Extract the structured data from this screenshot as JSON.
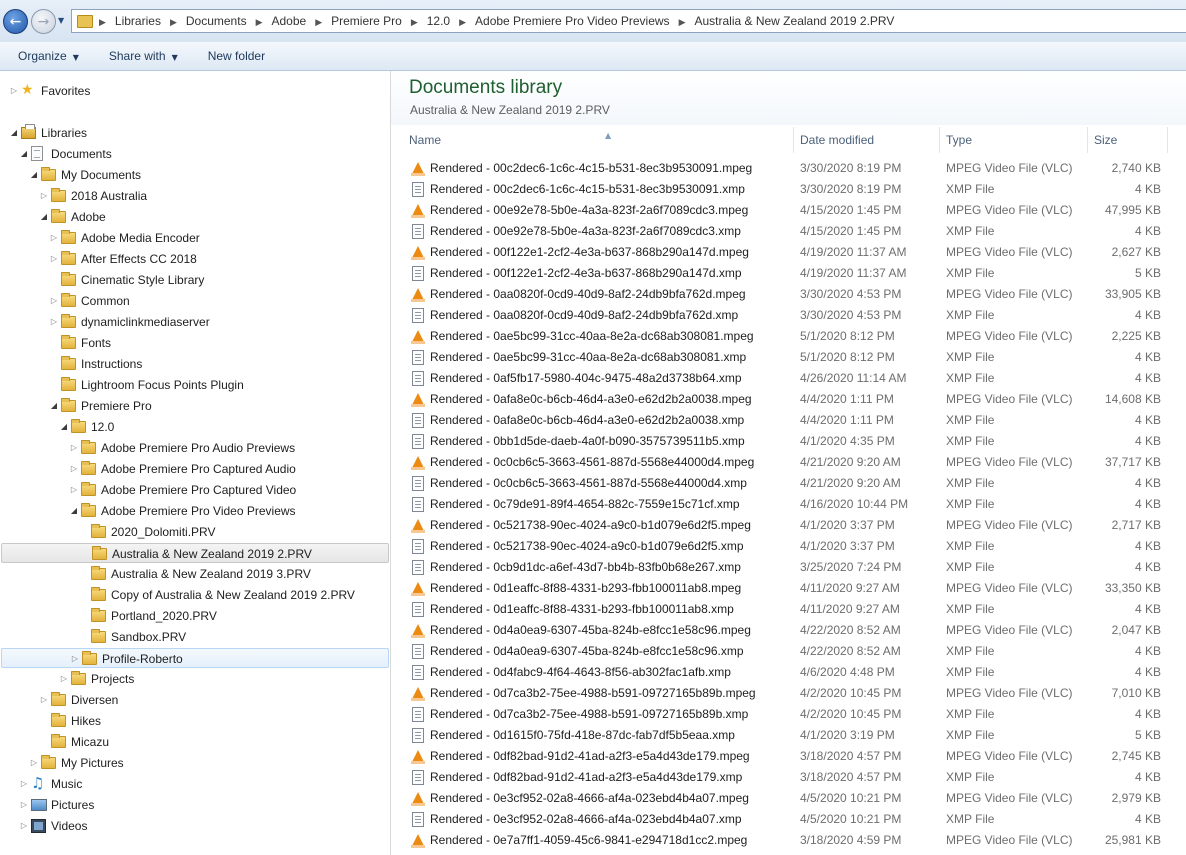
{
  "address_bar": {
    "breadcrumbs": [
      "Libraries",
      "Documents",
      "Adobe",
      "Premiere Pro",
      "12.0",
      "Adobe Premiere Pro Video Previews",
      "Australia & New Zealand 2019 2.PRV"
    ]
  },
  "toolbar": {
    "organize_label": "Organize",
    "share_label": "Share with",
    "new_folder_label": "New folder"
  },
  "nav_tree": [
    {
      "label": "Favorites",
      "level": 0,
      "icon": "star-icon",
      "arrow": "collapsed"
    },
    {
      "label": "Libraries",
      "level": 0,
      "icon": "library-icon",
      "arrow": "expanded"
    },
    {
      "label": "Documents",
      "level": 1,
      "icon": "document-library-icon",
      "arrow": "expanded"
    },
    {
      "label": "My Documents",
      "level": 2,
      "icon": "folder-icon",
      "arrow": "expanded"
    },
    {
      "label": "2018 Australia",
      "level": 3,
      "icon": "folder-icon",
      "arrow": "collapsed"
    },
    {
      "label": "Adobe",
      "level": 3,
      "icon": "folder-icon",
      "arrow": "expanded"
    },
    {
      "label": "Adobe Media Encoder",
      "level": 4,
      "icon": "folder-icon",
      "arrow": "collapsed"
    },
    {
      "label": "After Effects CC 2018",
      "level": 4,
      "icon": "folder-icon",
      "arrow": "collapsed"
    },
    {
      "label": "Cinematic Style Library",
      "level": 4,
      "icon": "folder-icon",
      "arrow": "none"
    },
    {
      "label": "Common",
      "level": 4,
      "icon": "folder-icon",
      "arrow": "collapsed"
    },
    {
      "label": "dynamiclinkmediaserver",
      "level": 4,
      "icon": "folder-icon",
      "arrow": "collapsed"
    },
    {
      "label": "Fonts",
      "level": 4,
      "icon": "folder-icon",
      "arrow": "none"
    },
    {
      "label": "Instructions",
      "level": 4,
      "icon": "folder-icon",
      "arrow": "none"
    },
    {
      "label": "Lightroom Focus Points Plugin",
      "level": 4,
      "icon": "folder-icon",
      "arrow": "none"
    },
    {
      "label": "Premiere Pro",
      "level": 4,
      "icon": "folder-icon",
      "arrow": "expanded"
    },
    {
      "label": "12.0",
      "level": 5,
      "icon": "folder-icon",
      "arrow": "expanded"
    },
    {
      "label": "Adobe Premiere Pro Audio Previews",
      "level": 6,
      "icon": "folder-icon",
      "arrow": "collapsed"
    },
    {
      "label": "Adobe Premiere Pro Captured Audio",
      "level": 6,
      "icon": "folder-icon",
      "arrow": "collapsed"
    },
    {
      "label": "Adobe Premiere Pro Captured Video",
      "level": 6,
      "icon": "folder-icon",
      "arrow": "collapsed"
    },
    {
      "label": "Adobe Premiere Pro Video Previews",
      "level": 6,
      "icon": "folder-icon",
      "arrow": "expanded"
    },
    {
      "label": "2020_Dolomiti.PRV",
      "level": 7,
      "icon": "folder-icon",
      "arrow": "none"
    },
    {
      "label": "Australia & New Zealand 2019 2.PRV",
      "level": 7,
      "icon": "folder-icon",
      "arrow": "none",
      "state": "selected"
    },
    {
      "label": "Australia & New Zealand 2019 3.PRV",
      "level": 7,
      "icon": "folder-icon",
      "arrow": "none"
    },
    {
      "label": "Copy of Australia & New Zealand 2019 2.PRV",
      "level": 7,
      "icon": "folder-icon",
      "arrow": "none"
    },
    {
      "label": "Portland_2020.PRV",
      "level": 7,
      "icon": "folder-icon",
      "arrow": "none"
    },
    {
      "label": "Sandbox.PRV",
      "level": 7,
      "icon": "folder-icon",
      "arrow": "none"
    },
    {
      "label": "Profile-Roberto",
      "level": 6,
      "icon": "folder-icon",
      "arrow": "collapsed",
      "state": "hovered"
    },
    {
      "label": "Projects",
      "level": 5,
      "icon": "folder-icon",
      "arrow": "collapsed"
    },
    {
      "label": "Diversen",
      "level": 3,
      "icon": "folder-icon",
      "arrow": "collapsed"
    },
    {
      "label": "Hikes",
      "level": 3,
      "icon": "folder-icon",
      "arrow": "none"
    },
    {
      "label": "Micazu",
      "level": 3,
      "icon": "folder-icon",
      "arrow": "none"
    },
    {
      "label": "My Pictures",
      "level": 2,
      "icon": "folder-icon",
      "arrow": "collapsed"
    },
    {
      "label": "Music",
      "level": 1,
      "icon": "music-library-icon",
      "arrow": "collapsed"
    },
    {
      "label": "Pictures",
      "level": 1,
      "icon": "pictures-library-icon",
      "arrow": "collapsed"
    },
    {
      "label": "Videos",
      "level": 1,
      "icon": "videos-library-icon",
      "arrow": "collapsed"
    }
  ],
  "library": {
    "title": "Documents library",
    "subtitle": "Australia & New Zealand 2019 2.PRV"
  },
  "columns": {
    "name": "Name",
    "date": "Date modified",
    "type": "Type",
    "size": "Size"
  },
  "files": [
    {
      "name": "Rendered - 00c2dec6-1c6c-4c15-b531-8ec3b9530091.mpeg",
      "date": "3/30/2020 8:19 PM",
      "type": "MPEG Video File (VLC)",
      "size": "2,740 KB",
      "icon": "vlc-icon"
    },
    {
      "name": "Rendered - 00c2dec6-1c6c-4c15-b531-8ec3b9530091.xmp",
      "date": "3/30/2020 8:19 PM",
      "type": "XMP File",
      "size": "4 KB",
      "icon": "xmp-file-icon"
    },
    {
      "name": "Rendered - 00e92e78-5b0e-4a3a-823f-2a6f7089cdc3.mpeg",
      "date": "4/15/2020 1:45 PM",
      "type": "MPEG Video File (VLC)",
      "size": "47,995 KB",
      "icon": "vlc-icon"
    },
    {
      "name": "Rendered - 00e92e78-5b0e-4a3a-823f-2a6f7089cdc3.xmp",
      "date": "4/15/2020 1:45 PM",
      "type": "XMP File",
      "size": "4 KB",
      "icon": "xmp-file-icon"
    },
    {
      "name": "Rendered - 00f122e1-2cf2-4e3a-b637-868b290a147d.mpeg",
      "date": "4/19/2020 11:37 AM",
      "type": "MPEG Video File (VLC)",
      "size": "2,627 KB",
      "icon": "vlc-icon"
    },
    {
      "name": "Rendered - 00f122e1-2cf2-4e3a-b637-868b290a147d.xmp",
      "date": "4/19/2020 11:37 AM",
      "type": "XMP File",
      "size": "5 KB",
      "icon": "xmp-file-icon"
    },
    {
      "name": "Rendered - 0aa0820f-0cd9-40d9-8af2-24db9bfa762d.mpeg",
      "date": "3/30/2020 4:53 PM",
      "type": "MPEG Video File (VLC)",
      "size": "33,905 KB",
      "icon": "vlc-icon"
    },
    {
      "name": "Rendered - 0aa0820f-0cd9-40d9-8af2-24db9bfa762d.xmp",
      "date": "3/30/2020 4:53 PM",
      "type": "XMP File",
      "size": "4 KB",
      "icon": "xmp-file-icon"
    },
    {
      "name": "Rendered - 0ae5bc99-31cc-40aa-8e2a-dc68ab308081.mpeg",
      "date": "5/1/2020 8:12 PM",
      "type": "MPEG Video File (VLC)",
      "size": "2,225 KB",
      "icon": "vlc-icon"
    },
    {
      "name": "Rendered - 0ae5bc99-31cc-40aa-8e2a-dc68ab308081.xmp",
      "date": "5/1/2020 8:12 PM",
      "type": "XMP File",
      "size": "4 KB",
      "icon": "xmp-file-icon"
    },
    {
      "name": "Rendered - 0af5fb17-5980-404c-9475-48a2d3738b64.xmp",
      "date": "4/26/2020 11:14 AM",
      "type": "XMP File",
      "size": "4 KB",
      "icon": "xmp-file-icon"
    },
    {
      "name": "Rendered - 0afa8e0c-b6cb-46d4-a3e0-e62d2b2a0038.mpeg",
      "date": "4/4/2020 1:11 PM",
      "type": "MPEG Video File (VLC)",
      "size": "14,608 KB",
      "icon": "vlc-icon"
    },
    {
      "name": "Rendered - 0afa8e0c-b6cb-46d4-a3e0-e62d2b2a0038.xmp",
      "date": "4/4/2020 1:11 PM",
      "type": "XMP File",
      "size": "4 KB",
      "icon": "xmp-file-icon"
    },
    {
      "name": "Rendered - 0bb1d5de-daeb-4a0f-b090-3575739511b5.xmp",
      "date": "4/1/2020 4:35 PM",
      "type": "XMP File",
      "size": "4 KB",
      "icon": "xmp-file-icon"
    },
    {
      "name": "Rendered - 0c0cb6c5-3663-4561-887d-5568e44000d4.mpeg",
      "date": "4/21/2020 9:20 AM",
      "type": "MPEG Video File (VLC)",
      "size": "37,717 KB",
      "icon": "vlc-icon"
    },
    {
      "name": "Rendered - 0c0cb6c5-3663-4561-887d-5568e44000d4.xmp",
      "date": "4/21/2020 9:20 AM",
      "type": "XMP File",
      "size": "4 KB",
      "icon": "xmp-file-icon"
    },
    {
      "name": "Rendered - 0c79de91-89f4-4654-882c-7559e15c71cf.xmp",
      "date": "4/16/2020 10:44 PM",
      "type": "XMP File",
      "size": "4 KB",
      "icon": "xmp-file-icon"
    },
    {
      "name": "Rendered - 0c521738-90ec-4024-a9c0-b1d079e6d2f5.mpeg",
      "date": "4/1/2020 3:37 PM",
      "type": "MPEG Video File (VLC)",
      "size": "2,717 KB",
      "icon": "vlc-icon"
    },
    {
      "name": "Rendered - 0c521738-90ec-4024-a9c0-b1d079e6d2f5.xmp",
      "date": "4/1/2020 3:37 PM",
      "type": "XMP File",
      "size": "4 KB",
      "icon": "xmp-file-icon"
    },
    {
      "name": "Rendered - 0cb9d1dc-a6ef-43d7-bb4b-83fb0b68e267.xmp",
      "date": "3/25/2020 7:24 PM",
      "type": "XMP File",
      "size": "4 KB",
      "icon": "xmp-file-icon"
    },
    {
      "name": "Rendered - 0d1eaffc-8f88-4331-b293-fbb100011ab8.mpeg",
      "date": "4/11/2020 9:27 AM",
      "type": "MPEG Video File (VLC)",
      "size": "33,350 KB",
      "icon": "vlc-icon"
    },
    {
      "name": "Rendered - 0d1eaffc-8f88-4331-b293-fbb100011ab8.xmp",
      "date": "4/11/2020 9:27 AM",
      "type": "XMP File",
      "size": "4 KB",
      "icon": "xmp-file-icon"
    },
    {
      "name": "Rendered - 0d4a0ea9-6307-45ba-824b-e8fcc1e58c96.mpeg",
      "date": "4/22/2020 8:52 AM",
      "type": "MPEG Video File (VLC)",
      "size": "2,047 KB",
      "icon": "vlc-icon"
    },
    {
      "name": "Rendered - 0d4a0ea9-6307-45ba-824b-e8fcc1e58c96.xmp",
      "date": "4/22/2020 8:52 AM",
      "type": "XMP File",
      "size": "4 KB",
      "icon": "xmp-file-icon"
    },
    {
      "name": "Rendered - 0d4fabc9-4f64-4643-8f56-ab302fac1afb.xmp",
      "date": "4/6/2020 4:48 PM",
      "type": "XMP File",
      "size": "4 KB",
      "icon": "xmp-file-icon"
    },
    {
      "name": "Rendered - 0d7ca3b2-75ee-4988-b591-09727165b89b.mpeg",
      "date": "4/2/2020 10:45 PM",
      "type": "MPEG Video File (VLC)",
      "size": "7,010 KB",
      "icon": "vlc-icon"
    },
    {
      "name": "Rendered - 0d7ca3b2-75ee-4988-b591-09727165b89b.xmp",
      "date": "4/2/2020 10:45 PM",
      "type": "XMP File",
      "size": "4 KB",
      "icon": "xmp-file-icon"
    },
    {
      "name": "Rendered - 0d1615f0-75fd-418e-87dc-fab7df5b5eaa.xmp",
      "date": "4/1/2020 3:19 PM",
      "type": "XMP File",
      "size": "5 KB",
      "icon": "xmp-file-icon"
    },
    {
      "name": "Rendered - 0df82bad-91d2-41ad-a2f3-e5a4d43de179.mpeg",
      "date": "3/18/2020 4:57 PM",
      "type": "MPEG Video File (VLC)",
      "size": "2,745 KB",
      "icon": "vlc-icon"
    },
    {
      "name": "Rendered - 0df82bad-91d2-41ad-a2f3-e5a4d43de179.xmp",
      "date": "3/18/2020 4:57 PM",
      "type": "XMP File",
      "size": "4 KB",
      "icon": "xmp-file-icon"
    },
    {
      "name": "Rendered - 0e3cf952-02a8-4666-af4a-023ebd4b4a07.mpeg",
      "date": "4/5/2020 10:21 PM",
      "type": "MPEG Video File (VLC)",
      "size": "2,979 KB",
      "icon": "vlc-icon"
    },
    {
      "name": "Rendered - 0e3cf952-02a8-4666-af4a-023ebd4b4a07.xmp",
      "date": "4/5/2020 10:21 PM",
      "type": "XMP File",
      "size": "4 KB",
      "icon": "xmp-file-icon"
    },
    {
      "name": "Rendered - 0e7a7ff1-4059-45c6-9841-e294718d1cc2.mpeg",
      "date": "3/18/2020 4:59 PM",
      "type": "MPEG Video File (VLC)",
      "size": "25,981 KB",
      "icon": "vlc-icon"
    }
  ]
}
